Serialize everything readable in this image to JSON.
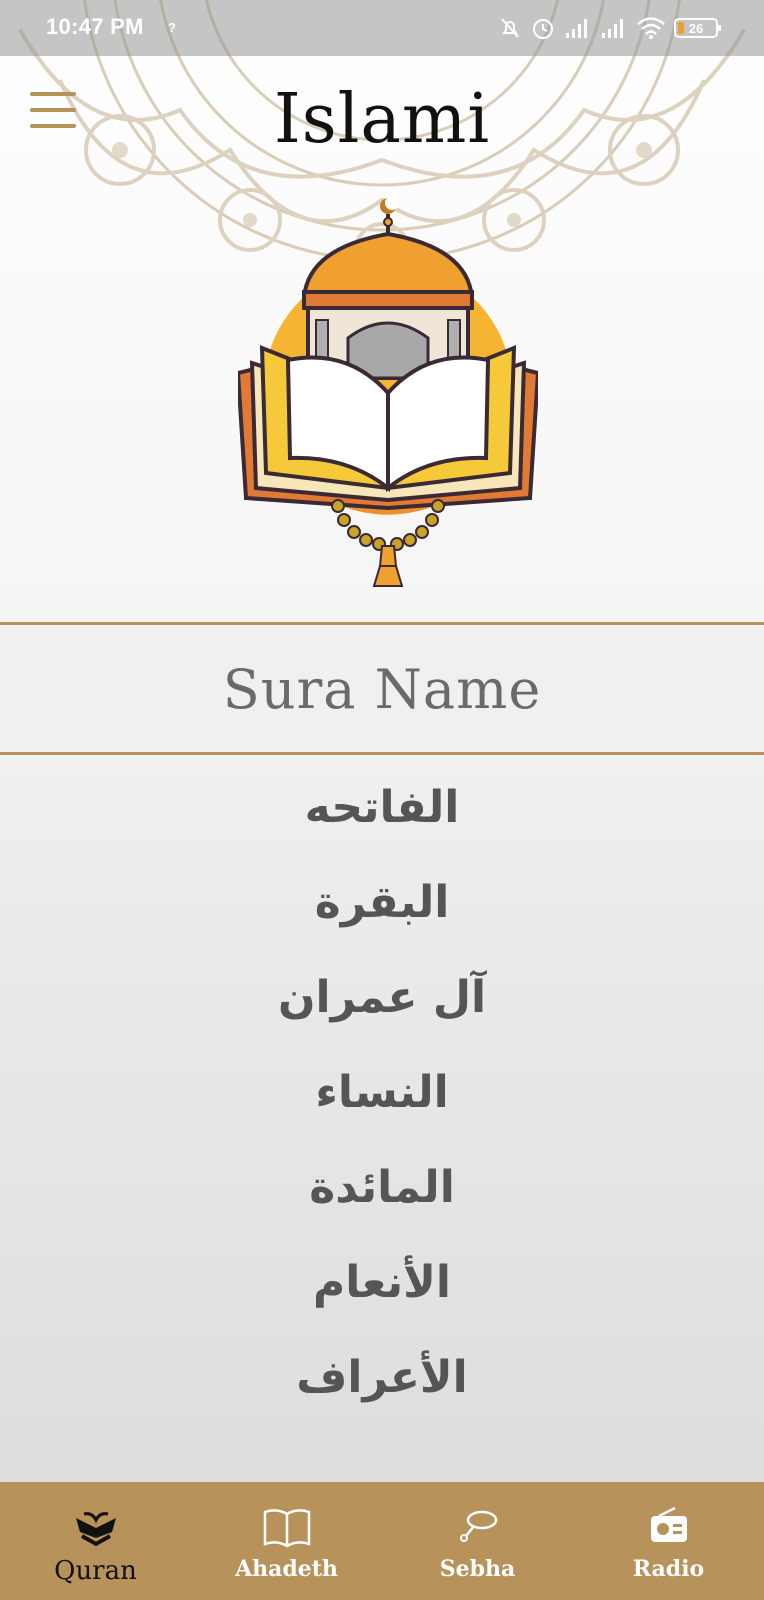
{
  "status_bar": {
    "time": "10:47 PM",
    "extra": "?",
    "battery": "26"
  },
  "header": {
    "title": "Islami"
  },
  "content": {
    "section_title": "Sura Name",
    "suras": [
      "الفاتحه",
      "البقرة",
      "آل عمران",
      "النساء",
      "المائدة",
      "الأنعام",
      "الأعراف"
    ]
  },
  "bottom_nav": {
    "items": [
      {
        "label": "Quran",
        "icon": "quran-icon",
        "active": true
      },
      {
        "label": "Ahadeth",
        "icon": "book-icon",
        "active": false
      },
      {
        "label": "Sebha",
        "icon": "sebha-icon",
        "active": false
      },
      {
        "label": "Radio",
        "icon": "radio-icon",
        "active": false
      }
    ]
  },
  "colors": {
    "accent": "#b7925b",
    "logo_orange": "#f0a030",
    "text_gray": "#555555"
  }
}
